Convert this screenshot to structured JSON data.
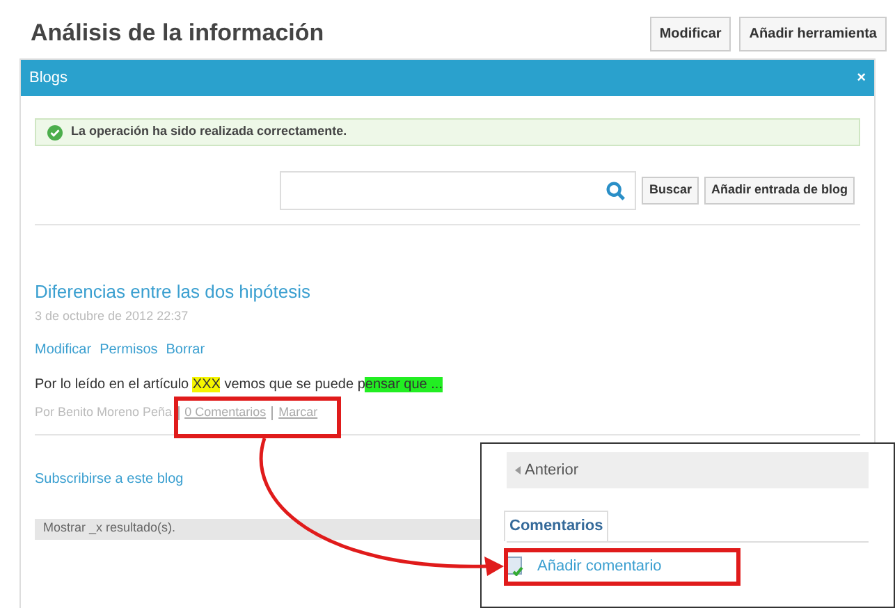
{
  "header": {
    "title": "Análisis de la información",
    "buttons": [
      "Modificar",
      "Añadir herramienta"
    ]
  },
  "panel": {
    "title": "Blogs",
    "close": "×"
  },
  "message": "La operación ha sido realizada correctamente.",
  "search": {
    "buttons": [
      "Buscar",
      "Añadir entrada de blog"
    ]
  },
  "post": {
    "title": "Diferencias entre las dos hipótesis",
    "date": "3 de octubre de 2012 22:37",
    "actions": [
      "Modificar",
      "Permisos",
      "Borrar"
    ],
    "body": [
      {
        "text": "Por lo leído en el artículo "
      },
      {
        "text": "XXX",
        "color": "#f5f500"
      },
      {
        "text": " vemos que se puede p"
      },
      {
        "text": "ensar que ...",
        "color": "#22ee22"
      }
    ],
    "author": "Por Benito Moreno Peña",
    "comments": "0 Comentarios",
    "flag": "Marcar"
  },
  "subscribe": "Subscribirse a este blog",
  "results": "Mostrar _x resultado(s).",
  "inset": {
    "back": "Anterior",
    "tab": "Comentarios",
    "add": "Añadir comentario"
  }
}
